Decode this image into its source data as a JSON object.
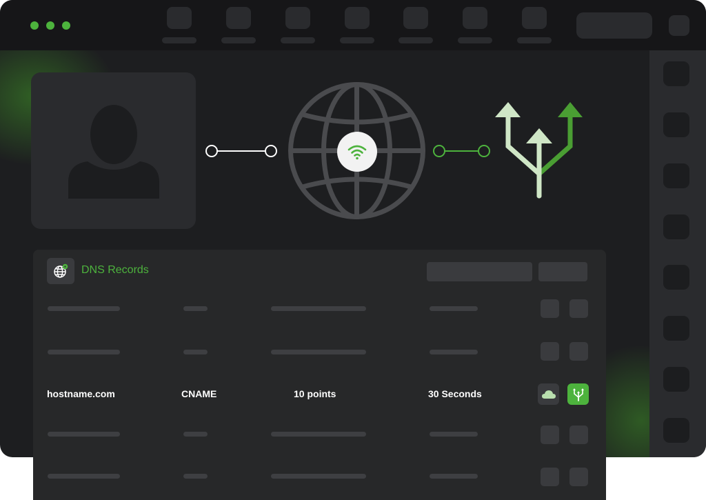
{
  "window": {
    "controls": [
      "dot-1",
      "dot-2",
      "dot-3"
    ],
    "accent": "#4db33d"
  },
  "illustration": {
    "icons": [
      "user-silhouette-icon",
      "globe-icon",
      "wifi-icon",
      "split-arrows-icon"
    ]
  },
  "panel": {
    "title": "DNS Records",
    "title_icon": "globe-settings-icon",
    "record": {
      "host": "hostname.com",
      "type": "CNAME",
      "value": "10 points",
      "ttl": "30 Seconds",
      "actions": [
        "cloud-icon",
        "split-arrows-icon"
      ]
    }
  }
}
